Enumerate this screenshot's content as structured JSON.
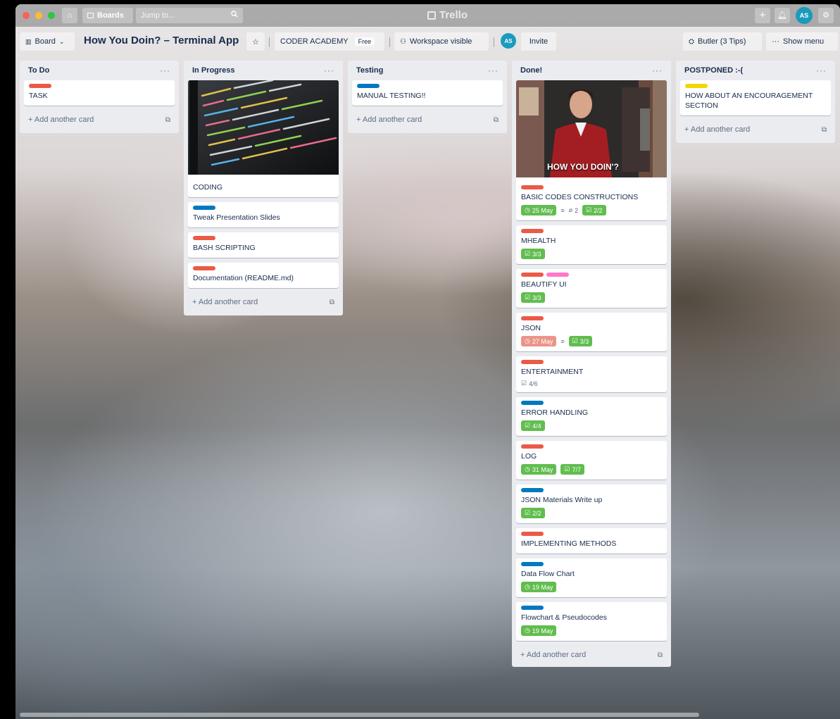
{
  "topbar": {
    "boards_label": "Boards",
    "jump_placeholder": "Jump to...",
    "app_name": "Trello",
    "avatar_initials": "AS"
  },
  "boardbar": {
    "view_label": "Board",
    "title": "How You Doin? – Terminal App",
    "workspace": "CODER ACADEMY",
    "plan_badge": "Free",
    "visibility": "Workspace visible",
    "member_initials": "AS",
    "invite_label": "Invite",
    "butler_label": "Butler (3 Tips)",
    "show_menu_label": "Show menu"
  },
  "add_card_label": "+ Add another card",
  "colors": {
    "red": "#eb5a46",
    "blue": "#0079bf",
    "yellow": "#f2d600",
    "pink": "#ff78cb",
    "green": "#61bd4f",
    "due_red": "#eb5a46"
  },
  "lists": [
    {
      "title": "To Do",
      "cards": [
        {
          "text": "TASK",
          "labels": [
            "red"
          ]
        }
      ]
    },
    {
      "title": "In Progress",
      "cards": [
        {
          "text": "CODING",
          "labels": [],
          "cover": "code-screen"
        },
        {
          "text": "Tweak Presentation Slides",
          "labels": [
            "blue"
          ]
        },
        {
          "text": "BASH SCRIPTING",
          "labels": [
            "red"
          ]
        },
        {
          "text": "Documentation (README.md)",
          "labels": [
            "red"
          ]
        }
      ]
    },
    {
      "title": "Testing",
      "cards": [
        {
          "text": "MANUAL TESTING!!",
          "labels": [
            "blue"
          ]
        }
      ]
    },
    {
      "title": "Done!",
      "cards": [
        {
          "text": "BASIC CODES CONSTRUCTIONS",
          "labels": [
            "red"
          ],
          "cover": "joey",
          "cover_caption": "HOW YOU DOIN'?",
          "due": "25 May",
          "due_state": "green",
          "description": true,
          "attachments": "2",
          "checklist": "2/2",
          "checklist_state": "green"
        },
        {
          "text": "MHEALTH",
          "labels": [
            "red"
          ],
          "checklist": "3/3",
          "checklist_state": "green"
        },
        {
          "text": "BEAUTIFY UI",
          "labels": [
            "red",
            "pink"
          ],
          "checklist": "3/3",
          "checklist_state": "green"
        },
        {
          "text": "JSON",
          "labels": [
            "red"
          ],
          "due": "27 May",
          "due_state": "red",
          "description": true,
          "checklist": "3/3",
          "checklist_state": "green"
        },
        {
          "text": "ENTERTAINMENT",
          "labels": [
            "red"
          ],
          "checklist": "4/6",
          "checklist_state": "plain"
        },
        {
          "text": "ERROR HANDLING",
          "labels": [
            "blue"
          ],
          "checklist": "4/4",
          "checklist_state": "green"
        },
        {
          "text": "LOG",
          "labels": [
            "red"
          ],
          "due": "31 May",
          "due_state": "green",
          "checklist": "7/7",
          "checklist_state": "green"
        },
        {
          "text": "JSON Materials Write up",
          "labels": [
            "blue"
          ],
          "checklist": "2/2",
          "checklist_state": "green"
        },
        {
          "text": "IMPLEMENTING METHODS",
          "labels": [
            "red"
          ]
        },
        {
          "text": "Data Flow Chart",
          "labels": [
            "blue"
          ],
          "due": "19 May",
          "due_state": "green"
        },
        {
          "text": "Flowchart & Pseudocodes",
          "labels": [
            "blue"
          ],
          "due": "19 May",
          "due_state": "green"
        }
      ]
    },
    {
      "title": "POSTPONED :-(",
      "cards": [
        {
          "text": "HOW ABOUT AN ENCOURAGEMENT SECTION",
          "labels": [
            "yellow"
          ]
        }
      ]
    }
  ]
}
